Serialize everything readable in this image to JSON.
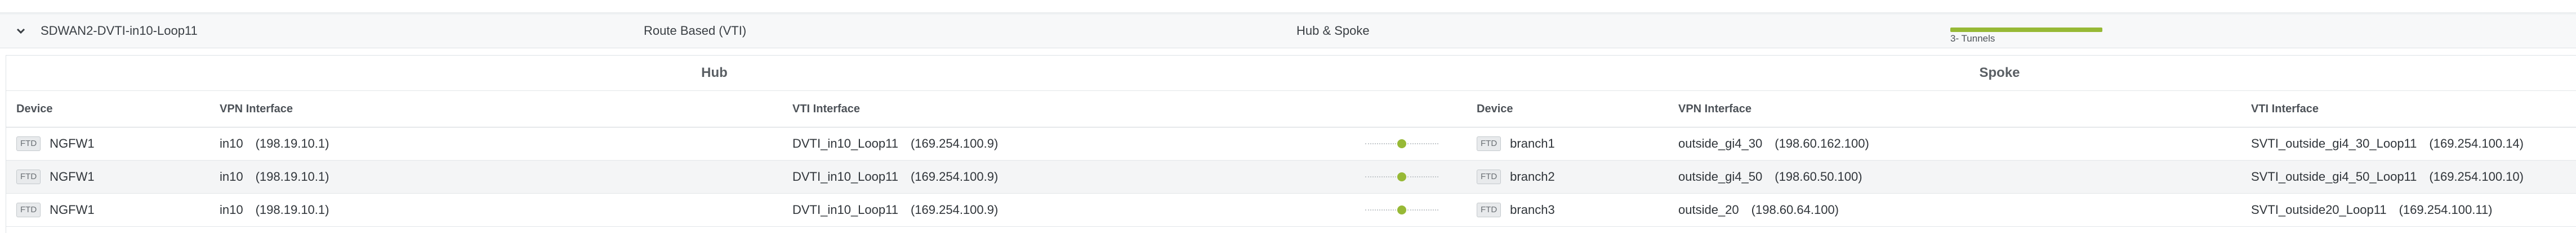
{
  "summary": {
    "topology_name": "SDWAN2-DVTI-in10-Loop11",
    "vpn_type": "Route Based (VTI)",
    "topology_type": "Hub & Spoke",
    "tunnels_label": "3- Tunnels",
    "status_color": "#97b936"
  },
  "groups": {
    "hub": "Hub",
    "spoke": "Spoke"
  },
  "columns": {
    "device": "Device",
    "vpn_interface": "VPN Interface",
    "vti_interface": "VTI Interface",
    "spoke_device": "Device",
    "spoke_vpn_interface": "VPN Interface",
    "spoke_vti_interface": "VTI Interface"
  },
  "rows": [
    {
      "hub": {
        "type": "FTD",
        "name": "NGFW1",
        "vpn_if": "in10",
        "vpn_ip": "(198.19.10.1)",
        "vti_if": "DVTI_in10_Loop11",
        "vti_ip": "(169.254.100.9)"
      },
      "spoke": {
        "type": "FTD",
        "name": "branch1",
        "vpn_if": "outside_gi4_30",
        "vpn_ip": "(198.60.162.100)",
        "vti_if": "SVTI_outside_gi4_30_Loop11",
        "vti_ip": "(169.254.100.14)"
      }
    },
    {
      "hub": {
        "type": "FTD",
        "name": "NGFW1",
        "vpn_if": "in10",
        "vpn_ip": "(198.19.10.1)",
        "vti_if": "DVTI_in10_Loop11",
        "vti_ip": "(169.254.100.9)"
      },
      "spoke": {
        "type": "FTD",
        "name": "branch2",
        "vpn_if": "outside_gi4_50",
        "vpn_ip": "(198.60.50.100)",
        "vti_if": "SVTI_outside_gi4_50_Loop11",
        "vti_ip": "(169.254.100.10)"
      }
    },
    {
      "hub": {
        "type": "FTD",
        "name": "NGFW1",
        "vpn_if": "in10",
        "vpn_ip": "(198.19.10.1)",
        "vti_if": "DVTI_in10_Loop11",
        "vti_ip": "(169.254.100.9)"
      },
      "spoke": {
        "type": "FTD",
        "name": "branch3",
        "vpn_if": "outside_20",
        "vpn_ip": "(198.60.64.100)",
        "vti_if": "SVTI_outside20_Loop11",
        "vti_ip": "(169.254.100.11)"
      }
    }
  ]
}
